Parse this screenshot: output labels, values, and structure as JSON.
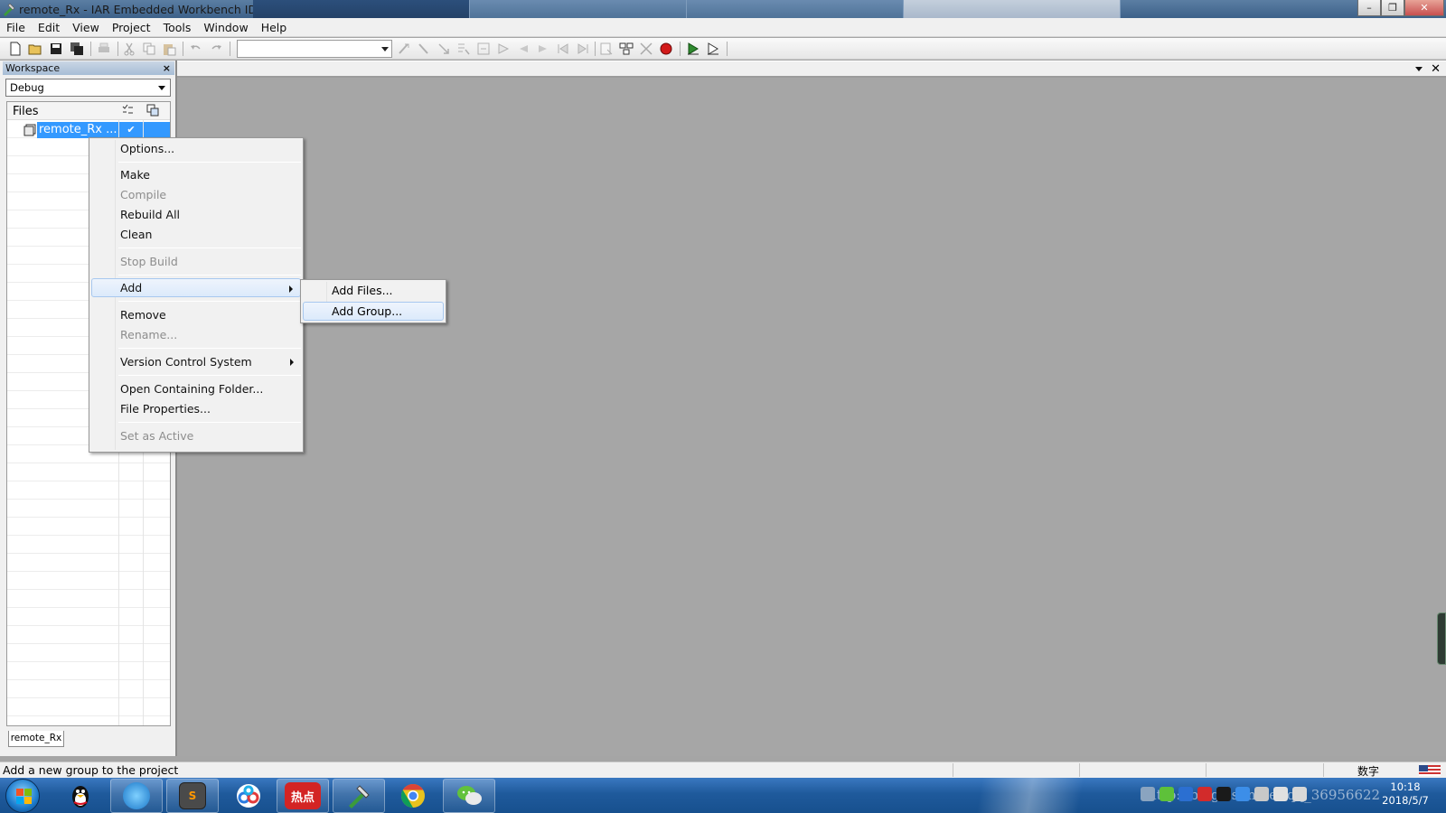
{
  "window": {
    "title": "remote_Rx - IAR Embedded Workbench IDE",
    "controls": {
      "minimize": "–",
      "restore": "❐",
      "close": "✕"
    }
  },
  "menubar": {
    "items": [
      "File",
      "Edit",
      "View",
      "Project",
      "Tools",
      "Window",
      "Help"
    ]
  },
  "toolbar": {
    "find_combo_value": ""
  },
  "workspace": {
    "title": "Workspace",
    "close": "×",
    "config": "Debug",
    "files_header": "Files",
    "project_name": "remote_Rx ...",
    "checkmark": "✔",
    "bottom_tab": "remote_Rx"
  },
  "editor": {
    "close": "✕"
  },
  "context_menu": {
    "items": [
      {
        "label": "Options...",
        "enabled": true
      },
      {
        "label": "Make",
        "enabled": true
      },
      {
        "label": "Compile",
        "enabled": false
      },
      {
        "label": "Rebuild All",
        "enabled": true
      },
      {
        "label": "Clean",
        "enabled": true
      },
      {
        "label": "Stop Build",
        "enabled": false
      },
      {
        "label": "Add",
        "enabled": true,
        "submenu": true,
        "highlighted": true
      },
      {
        "label": "Remove",
        "enabled": true
      },
      {
        "label": "Rename...",
        "enabled": false
      },
      {
        "label": "Version Control System",
        "enabled": true,
        "submenu": true
      },
      {
        "label": "Open Containing Folder...",
        "enabled": true
      },
      {
        "label": "File Properties...",
        "enabled": true
      },
      {
        "label": "Set as Active",
        "enabled": false
      }
    ]
  },
  "add_submenu": {
    "items": [
      {
        "label": "Add Files...",
        "highlighted": false
      },
      {
        "label": "Add Group...",
        "highlighted": true
      }
    ]
  },
  "statusbar": {
    "message": "Add a new group to the project",
    "ime": "数字"
  },
  "taskbar": {
    "hot_label": "热点",
    "clock_time": "10:18",
    "clock_date": "2018/5/7",
    "watermark": "http://blog.csdn.net/qq_36956622"
  },
  "colors": {
    "selection": "#3399ff",
    "editor_bg": "#a6a6a6",
    "taskbar": "#1f5a9c"
  }
}
